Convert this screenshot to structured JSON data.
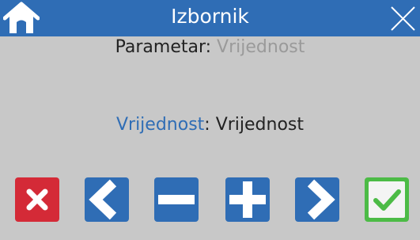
{
  "header": {
    "title": "Izbornik",
    "home_icon": "home-icon",
    "close_icon": "close-icon"
  },
  "parameter": {
    "label": "Parametar",
    "separator": ":",
    "value": " Vrijednost"
  },
  "value_row": {
    "label": "Vrijednost",
    "separator": ":",
    "value": " Vrijednost"
  },
  "buttons": [
    {
      "icon": "cancel-x-icon",
      "color": "#d42a37"
    },
    {
      "icon": "chevron-left-icon",
      "color": "#2f6db5"
    },
    {
      "icon": "minus-icon",
      "color": "#2f6db5"
    },
    {
      "icon": "plus-icon",
      "color": "#2f6db5"
    },
    {
      "icon": "chevron-right-icon",
      "color": "#2f6db5"
    },
    {
      "icon": "checkmark-icon",
      "color": "#4cbb46"
    }
  ],
  "colors": {
    "accent": "#2f6db5",
    "background": "#c8c8c8",
    "muted_text": "#9a9a9a",
    "danger": "#d42a37",
    "success": "#4cbb46"
  }
}
